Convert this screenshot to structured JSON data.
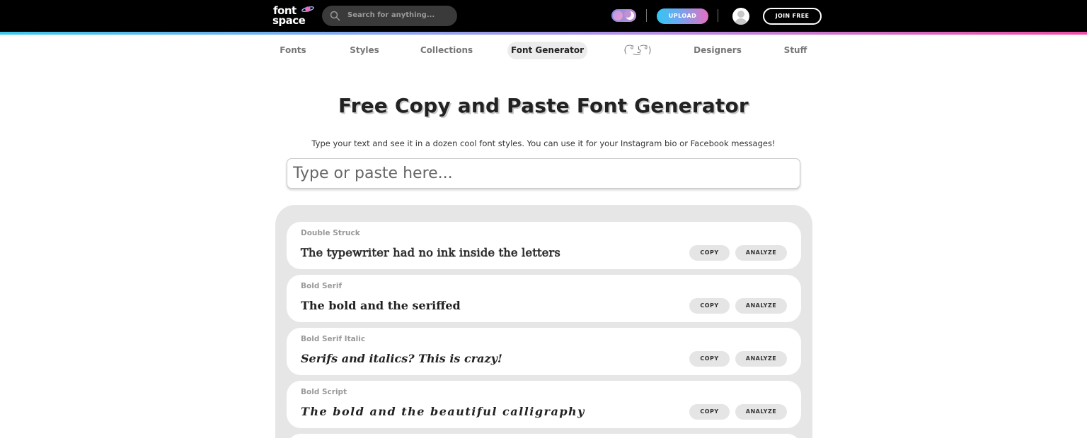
{
  "header": {
    "logo": {
      "line1": "font",
      "line2": "space"
    },
    "search": {
      "placeholder": "Search for anything..."
    },
    "upload_label": "UPLOAD",
    "join_label": "JOIN FREE"
  },
  "nav": {
    "items": [
      {
        "label": "Fonts"
      },
      {
        "label": "Styles"
      },
      {
        "label": "Collections"
      },
      {
        "label": "Font Generator",
        "active": true
      },
      {
        "label": "( ͡° ͜ʖ ͡°)"
      },
      {
        "label": "Designers"
      },
      {
        "label": "Stuff"
      }
    ]
  },
  "main": {
    "title": "Free Copy and Paste Font Generator",
    "subtitle": "Type your text and see it in a dozen cool font styles. You can use it for your Instagram bio or Facebook messages!",
    "input_placeholder": "Type or paste here..."
  },
  "results": [
    {
      "name": "Double Struck",
      "sample": "The typewriter had no ink inside the letters",
      "copy": "COPY",
      "analyze": "ANALYZE"
    },
    {
      "name": "Bold Serif",
      "sample": "The bold and the seriffed",
      "copy": "COPY",
      "analyze": "ANALYZE"
    },
    {
      "name": "Bold Serif Italic",
      "sample": "Serifs and italics? This is crazy!",
      "copy": "COPY",
      "analyze": "ANALYZE"
    },
    {
      "name": "Bold Script",
      "sample": "The bold and the beautiful calligraphy",
      "copy": "COPY",
      "analyze": "ANALYZE"
    }
  ],
  "colors": {
    "topbar": "#000000",
    "accent_gradient": [
      "#3cc8ec",
      "#ee4fa6"
    ],
    "panel": "#e6e6e6"
  },
  "icons": [
    "planet-logo-icon",
    "search-icon",
    "theme-toggle-icon",
    "moon-icon",
    "avatar-icon"
  ]
}
